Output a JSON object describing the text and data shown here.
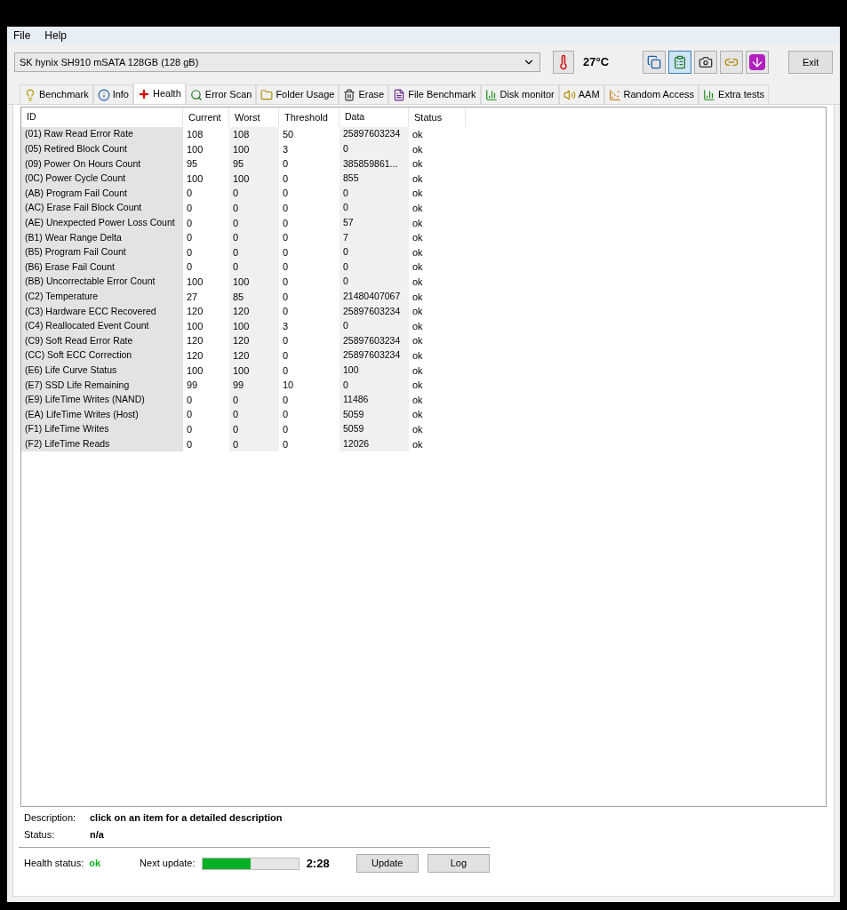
{
  "menu": [
    {
      "label": "File"
    },
    {
      "label": "Help"
    }
  ],
  "drive_select": {
    "value": "SK hynix SH910 mSATA 128GB (128 gB)"
  },
  "temperature": "27°C",
  "toolbar_buttons": [
    {
      "kind": "copy",
      "selected": false
    },
    {
      "kind": "copy-info",
      "selected": true
    },
    {
      "kind": "camera",
      "selected": false
    },
    {
      "kind": "chain",
      "selected": false
    },
    {
      "kind": "download",
      "selected": false
    }
  ],
  "exit_button": "Exit",
  "tabs": [
    {
      "label": "Benchmark",
      "kind": "bulb",
      "selected": false
    },
    {
      "label": "Info",
      "kind": "info",
      "selected": false
    },
    {
      "label": "Health",
      "kind": "cross",
      "selected": true
    },
    {
      "label": "Error Scan",
      "kind": "search",
      "selected": false
    },
    {
      "label": "Folder Usage",
      "kind": "folder",
      "selected": false
    },
    {
      "label": "Erase",
      "kind": "trash",
      "selected": false
    },
    {
      "label": "File Benchmark",
      "kind": "file",
      "selected": false
    },
    {
      "label": "Disk monitor",
      "kind": "chart",
      "selected": false
    },
    {
      "label": "AAM",
      "kind": "speaker",
      "selected": false
    },
    {
      "label": "Random Access",
      "kind": "scatter",
      "selected": false
    },
    {
      "label": "Extra tests",
      "kind": "chart",
      "selected": false
    }
  ],
  "table": {
    "columns": [
      "ID",
      "Current",
      "Worst",
      "Threshold",
      "Data",
      "Status"
    ],
    "rows": [
      [
        "(01) Raw Read Error Rate",
        "108",
        "108",
        "50",
        "25897603234",
        "ok"
      ],
      [
        "(05) Retired Block Count",
        "100",
        "100",
        "3",
        "0",
        "ok"
      ],
      [
        "(09) Power On Hours Count",
        "95",
        "95",
        "0",
        "385859861...",
        "ok"
      ],
      [
        "(0C) Power Cycle Count",
        "100",
        "100",
        "0",
        "855",
        "ok"
      ],
      [
        "(AB) Program Fail Count",
        "0",
        "0",
        "0",
        "0",
        "ok"
      ],
      [
        "(AC) Erase Fail Block Count",
        "0",
        "0",
        "0",
        "0",
        "ok"
      ],
      [
        "(AE) Unexpected Power Loss Count",
        "0",
        "0",
        "0",
        "57",
        "ok"
      ],
      [
        "(B1) Wear Range Delta",
        "0",
        "0",
        "0",
        "7",
        "ok"
      ],
      [
        "(B5) Program Fail Count",
        "0",
        "0",
        "0",
        "0",
        "ok"
      ],
      [
        "(B6) Erase Fail Count",
        "0",
        "0",
        "0",
        "0",
        "ok"
      ],
      [
        "(BB) Uncorrectable Error Count",
        "100",
        "100",
        "0",
        "0",
        "ok"
      ],
      [
        "(C2) Temperature",
        "27",
        "85",
        "0",
        "21480407067",
        "ok"
      ],
      [
        "(C3) Hardware ECC Recovered",
        "120",
        "120",
        "0",
        "25897603234",
        "ok"
      ],
      [
        "(C4) Reallocated Event Count",
        "100",
        "100",
        "3",
        "0",
        "ok"
      ],
      [
        "(C9) Soft Read Error Rate",
        "120",
        "120",
        "0",
        "25897603234",
        "ok"
      ],
      [
        "(CC) Soft ECC Correction",
        "120",
        "120",
        "0",
        "25897603234",
        "ok"
      ],
      [
        "(E6) Life Curve Status",
        "100",
        "100",
        "0",
        "100",
        "ok"
      ],
      [
        "(E7) SSD Life Remaining",
        "99",
        "99",
        "10",
        "0",
        "ok"
      ],
      [
        "(E9) LifeTime Writes (NAND)",
        "0",
        "0",
        "0",
        "11486",
        "ok"
      ],
      [
        "(EA) LifeTime Writes (Host)",
        "0",
        "0",
        "0",
        "5059",
        "ok"
      ],
      [
        "(F1) LifeTime Writes",
        "0",
        "0",
        "0",
        "5059",
        "ok"
      ],
      [
        "(F2) LifeTime Reads",
        "0",
        "0",
        "0",
        "12026",
        "ok"
      ]
    ]
  },
  "description": {
    "label": "Description:",
    "value": "click on an item for a detailed description"
  },
  "status": {
    "label": "Status:",
    "value": "n/a"
  },
  "health_status": {
    "label": "Health status:",
    "value": "ok"
  },
  "next_update": {
    "label": "Next update:",
    "level": 0.5,
    "time": "2:28"
  },
  "buttons": [
    "Update",
    "Log"
  ]
}
